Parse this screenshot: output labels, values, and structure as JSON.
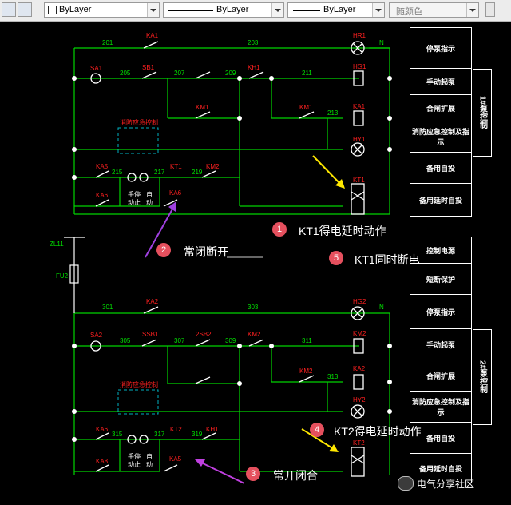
{
  "toolbar": {
    "layer_label": "ByLayer",
    "linetype_label": "ByLayer",
    "lineweight_label": "ByLayer",
    "color_label": "随颜色"
  },
  "panel_top": {
    "rows": [
      "停泵指示",
      "手动起泵",
      "合闸扩展",
      "消防应急控制及指示",
      "备用自投",
      "备用延时自投"
    ],
    "side_label": "1#泵控制"
  },
  "panel_bottom": {
    "rows": [
      "控制电源",
      "短断保护",
      "停泵指示",
      "手动起泵",
      "合闸扩展",
      "消防应急控制及指示",
      "备用自投",
      "备用延时自投"
    ],
    "side_label": "2#泵控制"
  },
  "annotations": [
    {
      "num": "1",
      "text": "KT1得电延时动作"
    },
    {
      "num": "2",
      "text": "常闭断开"
    },
    {
      "num": "5",
      "text": "KT1同时断电"
    },
    {
      "num": "4",
      "text": "KT2得电延时动作"
    },
    {
      "num": "3",
      "text": "常开闭合"
    }
  ],
  "watermark": "电气分享社区",
  "schematic": {
    "wire_labels_top": [
      "201",
      "203",
      "205",
      "207",
      "209",
      "211",
      "213",
      "215",
      "217",
      "219"
    ],
    "wire_labels_bottom": [
      "301",
      "303",
      "305",
      "307",
      "309",
      "311",
      "313",
      "315",
      "317",
      "319"
    ],
    "components_top": [
      "SA1",
      "SB1",
      "KM1",
      "KH1",
      "KA1",
      "HR1",
      "HG1",
      "KM1",
      "KA5",
      "KA6",
      "KT1",
      "KT1",
      "HY1"
    ],
    "components_bottom": [
      "SA2",
      "SB2",
      "2SB2",
      "KM2",
      "KH2",
      "KA2",
      "HR2",
      "HG2",
      "KM2",
      "KA6",
      "KA8",
      "KT2",
      "KT2",
      "HY2"
    ],
    "mid_labels": [
      "ZL11",
      "FU2"
    ],
    "neutral_label": "N",
    "small_labels": [
      "手停",
      "自",
      "动",
      "止",
      "动"
    ],
    "emergency_label_top": "消防应急控制",
    "emergency_label_bottom": "消防应急控制"
  },
  "colors": {
    "wire": "#00d400",
    "label": "#00e000",
    "component": "#ffffff",
    "red_label": "#ff2020",
    "arrow_yellow": "#ffe800",
    "arrow_purple": "#a040e0"
  }
}
